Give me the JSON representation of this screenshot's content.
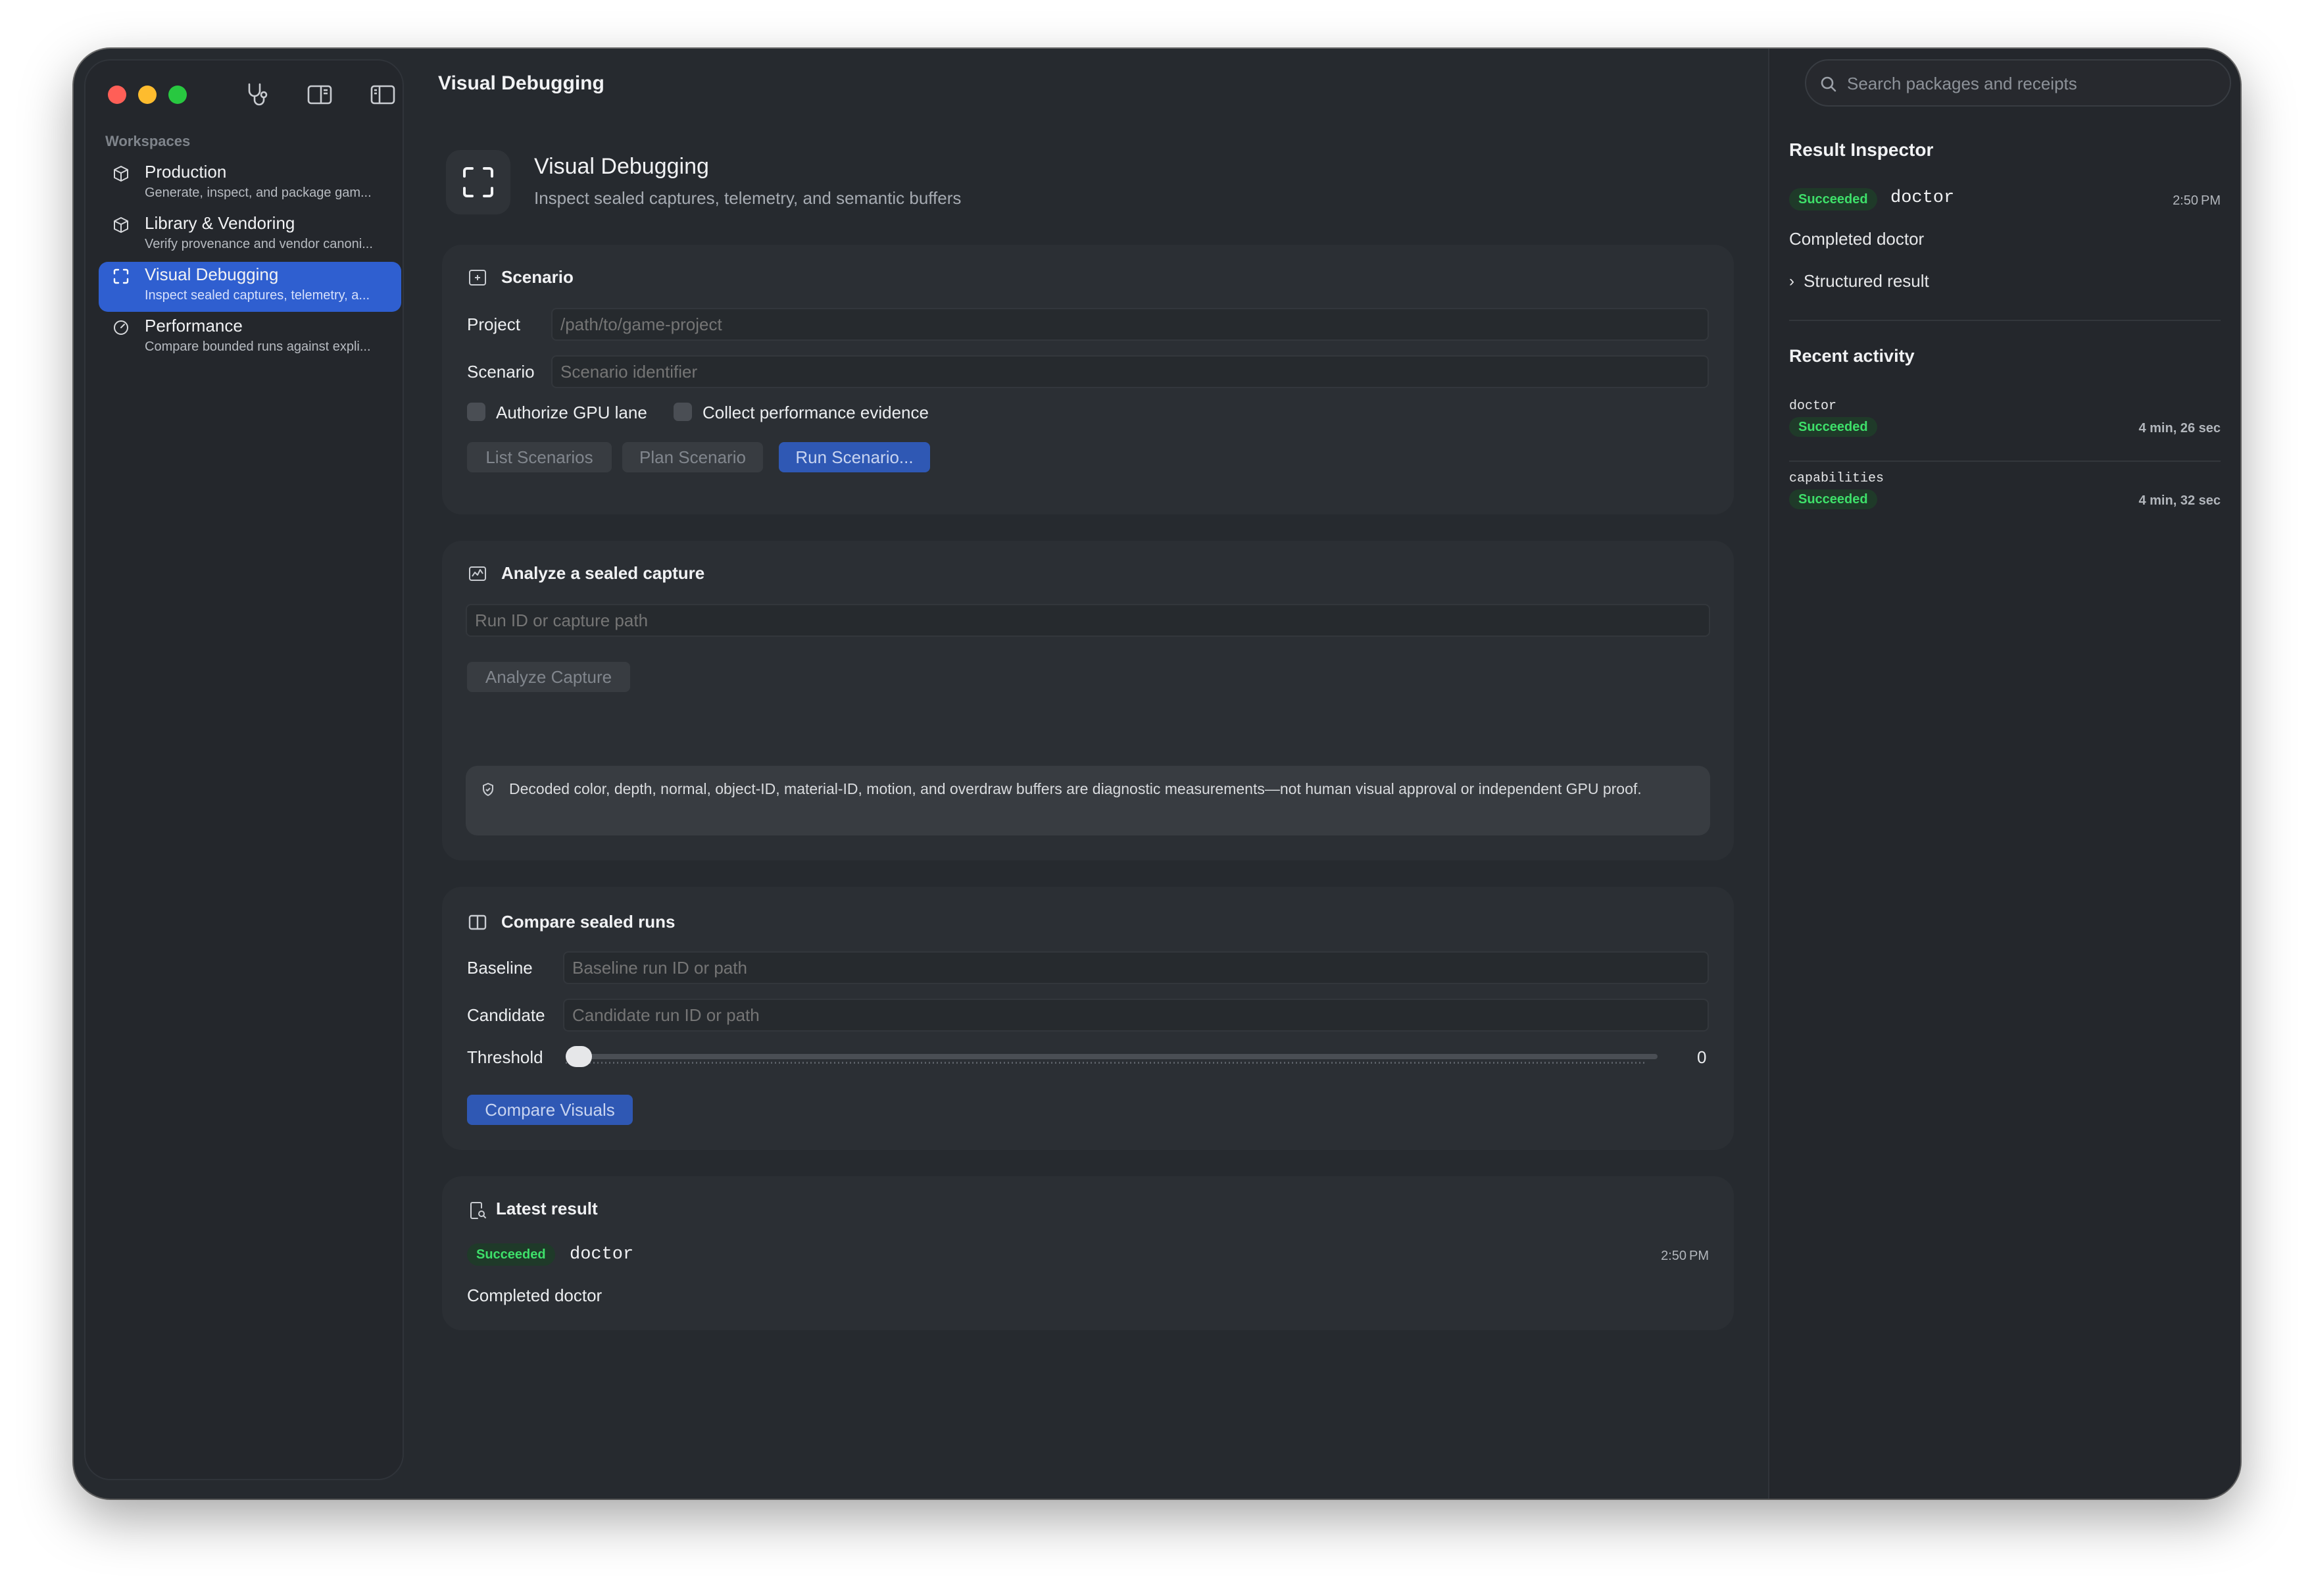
{
  "sidebar": {
    "section_label": "Workspaces",
    "items": [
      {
        "title": "Production",
        "subtitle": "Generate, inspect, and package gam...",
        "icon": "cube-icon"
      },
      {
        "title": "Library & Vendoring",
        "subtitle": "Verify provenance and vendor canoni...",
        "icon": "cube-icon"
      },
      {
        "title": "Visual Debugging",
        "subtitle": "Inspect sealed captures, telemetry, a...",
        "icon": "viewfinder-icon",
        "active": true
      },
      {
        "title": "Performance",
        "subtitle": "Compare bounded runs against expli...",
        "icon": "gauge-icon"
      }
    ]
  },
  "toolbar": {
    "title": "Visual Debugging",
    "icons": [
      "stethoscope-icon",
      "split-view-icon",
      "sidebar-toggle-icon"
    ]
  },
  "header": {
    "title": "Visual Debugging",
    "subtitle": "Inspect sealed captures, telemetry, and semantic buffers"
  },
  "scenario": {
    "title": "Scenario",
    "project_label": "Project",
    "project_placeholder": "/path/to/game-project",
    "scenario_label": "Scenario",
    "scenario_placeholder": "Scenario identifier",
    "gpu_label": "Authorize GPU lane",
    "perf_label": "Collect performance evidence",
    "list_button": "List Scenarios",
    "plan_button": "Plan Scenario",
    "run_button": "Run Scenario..."
  },
  "analyze": {
    "title": "Analyze a sealed capture",
    "input_placeholder": "Run ID or capture path",
    "button": "Analyze Capture",
    "notice": "Decoded color, depth, normal, object-ID, material-ID, motion, and overdraw buffers are diagnostic measurements—not human visual approval or independent GPU proof."
  },
  "compare": {
    "title": "Compare sealed runs",
    "baseline_label": "Baseline",
    "baseline_placeholder": "Baseline run ID or path",
    "candidate_label": "Candidate",
    "candidate_placeholder": "Candidate run ID or path",
    "threshold_label": "Threshold",
    "threshold_value": "0",
    "button": "Compare Visuals"
  },
  "latest": {
    "title": "Latest result",
    "status": "Succeeded",
    "command": "doctor",
    "time": "2:50 PM",
    "message": "Completed doctor"
  },
  "inspector": {
    "search_placeholder": "Search packages and receipts",
    "title": "Result Inspector",
    "status": "Succeeded",
    "command": "doctor",
    "time": "2:50 PM",
    "message": "Completed doctor",
    "disclosure": "Structured result",
    "recent_title": "Recent activity",
    "recent": [
      {
        "command": "doctor",
        "status": "Succeeded",
        "duration": "4 min, 26 sec"
      },
      {
        "command": "capabilities",
        "status": "Succeeded",
        "duration": "4 min, 32 sec"
      }
    ]
  },
  "colors": {
    "accent": "#2f5fd0",
    "success_text": "#3ee06a",
    "success_bg": "#1f3a29"
  }
}
